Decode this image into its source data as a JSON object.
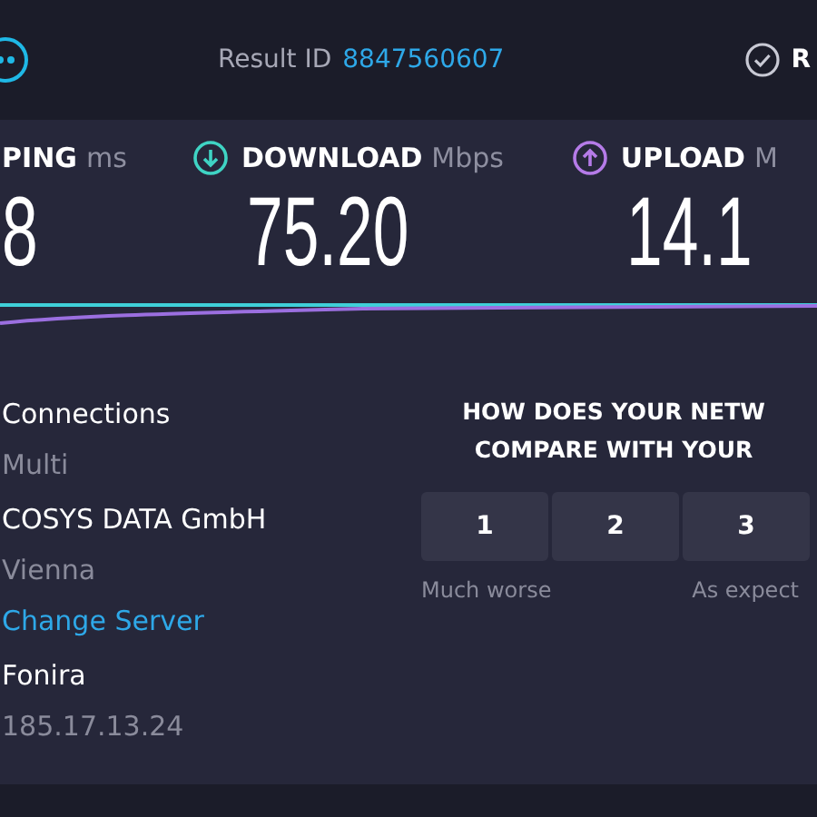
{
  "header": {
    "result_label": "Result ID",
    "result_id": "8847560607",
    "results_label": "R"
  },
  "metrics": [
    {
      "kind": "ping",
      "label": "PING",
      "unit": "ms",
      "value": "8"
    },
    {
      "kind": "download",
      "label": "DOWNLOAD",
      "unit": "Mbps",
      "value": "75.20"
    },
    {
      "kind": "upload",
      "label": "UPLOAD",
      "unit": "M",
      "value": "14.1"
    }
  ],
  "server_info": [
    {
      "kind": "title",
      "text": "Connections"
    },
    {
      "kind": "detail",
      "text": "Multi"
    },
    {
      "kind": "title",
      "text": "COSYS DATA GmbH"
    },
    {
      "kind": "detail",
      "text": "Vienna"
    },
    {
      "kind": "link",
      "text": "Change Server"
    },
    {
      "kind": "title",
      "text": "Fonira"
    },
    {
      "kind": "detail",
      "text": "185.17.13.24"
    }
  ],
  "survey": {
    "question_lines": [
      "HOW DOES YOUR NETW",
      "COMPARE WITH YOUR"
    ],
    "options": [
      "1",
      "2",
      "3"
    ],
    "labels": [
      "Much worse",
      "As expect"
    ]
  }
}
